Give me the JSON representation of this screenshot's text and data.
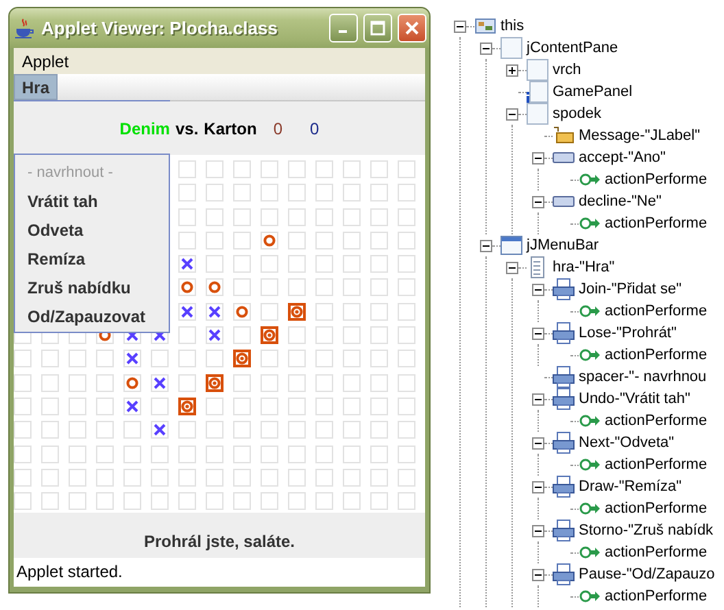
{
  "window": {
    "title": "Applet Viewer: Plocha.class"
  },
  "menu_bar": [
    {
      "label": "Applet"
    }
  ],
  "applet": {
    "menu_bar": [
      {
        "label": "Hra",
        "selected": true
      }
    ],
    "popup_menu": [
      {
        "label": "- navrhnout -",
        "disabled": true
      },
      {
        "label": "Vrátit tah",
        "disabled": false
      },
      {
        "label": "Odveta",
        "disabled": false
      },
      {
        "label": "Remíza",
        "disabled": false
      },
      {
        "label": "Zruš nabídku",
        "disabled": false
      },
      {
        "label": "Od/Zapauzovat",
        "disabled": false
      }
    ],
    "score": {
      "players": [
        {
          "name": "Denim",
          "active": true
        },
        {
          "name": "Karton",
          "active": false
        }
      ],
      "versus": "vs.",
      "score_1": "0",
      "score_2": "0"
    },
    "board": {
      "rows": [
        {
          "cells": [
            {
              "kind": "hidden"
            },
            {
              "kind": "hidden"
            },
            {
              "kind": "hidden"
            },
            {
              "kind": "hidden"
            },
            {
              "kind": "hidden"
            },
            {
              "kind": "hidden"
            },
            {
              "kind": "empty"
            },
            {
              "kind": "empty"
            },
            {
              "kind": "empty"
            },
            {
              "kind": "empty"
            },
            {
              "kind": "empty"
            },
            {
              "kind": "empty"
            },
            {
              "kind": "empty"
            },
            {
              "kind": "empty"
            },
            {
              "kind": "empty"
            }
          ]
        },
        {
          "cells": [
            {
              "kind": "hidden"
            },
            {
              "kind": "hidden"
            },
            {
              "kind": "hidden"
            },
            {
              "kind": "hidden"
            },
            {
              "kind": "hidden"
            },
            {
              "kind": "hidden"
            },
            {
              "kind": "empty"
            },
            {
              "kind": "empty"
            },
            {
              "kind": "empty"
            },
            {
              "kind": "empty"
            },
            {
              "kind": "empty"
            },
            {
              "kind": "empty"
            },
            {
              "kind": "empty"
            },
            {
              "kind": "empty"
            },
            {
              "kind": "empty"
            }
          ]
        },
        {
          "cells": [
            {
              "kind": "hidden"
            },
            {
              "kind": "hidden"
            },
            {
              "kind": "hidden"
            },
            {
              "kind": "hidden"
            },
            {
              "kind": "hidden"
            },
            {
              "kind": "hidden"
            },
            {
              "kind": "empty"
            },
            {
              "kind": "empty"
            },
            {
              "kind": "empty"
            },
            {
              "kind": "empty"
            },
            {
              "kind": "empty"
            },
            {
              "kind": "empty"
            },
            {
              "kind": "empty"
            },
            {
              "kind": "empty"
            },
            {
              "kind": "empty"
            }
          ]
        },
        {
          "cells": [
            {
              "kind": "hidden"
            },
            {
              "kind": "hidden"
            },
            {
              "kind": "hidden"
            },
            {
              "kind": "hidden"
            },
            {
              "kind": "hidden"
            },
            {
              "kind": "hidden"
            },
            {
              "kind": "empty"
            },
            {
              "kind": "empty"
            },
            {
              "kind": "empty"
            },
            {
              "kind": "ring"
            },
            {
              "kind": "empty"
            },
            {
              "kind": "empty"
            },
            {
              "kind": "empty"
            },
            {
              "kind": "empty"
            },
            {
              "kind": "empty"
            }
          ]
        },
        {
          "cells": [
            {
              "kind": "hidden"
            },
            {
              "kind": "hidden"
            },
            {
              "kind": "hidden"
            },
            {
              "kind": "hidden"
            },
            {
              "kind": "hidden"
            },
            {
              "kind": "hidden"
            },
            {
              "kind": "cross"
            },
            {
              "kind": "empty"
            },
            {
              "kind": "empty"
            },
            {
              "kind": "empty"
            },
            {
              "kind": "empty"
            },
            {
              "kind": "empty"
            },
            {
              "kind": "empty"
            },
            {
              "kind": "empty"
            },
            {
              "kind": "empty"
            }
          ]
        },
        {
          "cells": [
            {
              "kind": "hidden"
            },
            {
              "kind": "hidden"
            },
            {
              "kind": "hidden"
            },
            {
              "kind": "hidden"
            },
            {
              "kind": "hidden"
            },
            {
              "kind": "hidden"
            },
            {
              "kind": "ring"
            },
            {
              "kind": "ring"
            },
            {
              "kind": "empty"
            },
            {
              "kind": "empty"
            },
            {
              "kind": "empty"
            },
            {
              "kind": "empty"
            },
            {
              "kind": "empty"
            },
            {
              "kind": "empty"
            },
            {
              "kind": "empty"
            }
          ]
        },
        {
          "cells": [
            {
              "kind": "hidden"
            },
            {
              "kind": "hidden"
            },
            {
              "kind": "hidden"
            },
            {
              "kind": "hidden"
            },
            {
              "kind": "hidden"
            },
            {
              "kind": "hidden"
            },
            {
              "kind": "cross"
            },
            {
              "kind": "cross"
            },
            {
              "kind": "ring"
            },
            {
              "kind": "empty"
            },
            {
              "kind": "winning-ring"
            },
            {
              "kind": "empty"
            },
            {
              "kind": "empty"
            },
            {
              "kind": "empty"
            },
            {
              "kind": "empty"
            }
          ]
        },
        {
          "cells": [
            {
              "kind": "empty"
            },
            {
              "kind": "empty"
            },
            {
              "kind": "empty"
            },
            {
              "kind": "ring"
            },
            {
              "kind": "cross"
            },
            {
              "kind": "cross"
            },
            {
              "kind": "empty"
            },
            {
              "kind": "cross"
            },
            {
              "kind": "empty"
            },
            {
              "kind": "winning-ring"
            },
            {
              "kind": "empty"
            },
            {
              "kind": "empty"
            },
            {
              "kind": "empty"
            },
            {
              "kind": "empty"
            },
            {
              "kind": "empty"
            }
          ]
        },
        {
          "cells": [
            {
              "kind": "empty"
            },
            {
              "kind": "empty"
            },
            {
              "kind": "empty"
            },
            {
              "kind": "empty"
            },
            {
              "kind": "cross"
            },
            {
              "kind": "empty"
            },
            {
              "kind": "empty"
            },
            {
              "kind": "empty"
            },
            {
              "kind": "winning-ring"
            },
            {
              "kind": "empty"
            },
            {
              "kind": "empty"
            },
            {
              "kind": "empty"
            },
            {
              "kind": "empty"
            },
            {
              "kind": "empty"
            },
            {
              "kind": "empty"
            }
          ]
        },
        {
          "cells": [
            {
              "kind": "empty"
            },
            {
              "kind": "empty"
            },
            {
              "kind": "empty"
            },
            {
              "kind": "empty"
            },
            {
              "kind": "ring"
            },
            {
              "kind": "cross"
            },
            {
              "kind": "empty"
            },
            {
              "kind": "winning-ring"
            },
            {
              "kind": "empty"
            },
            {
              "kind": "empty"
            },
            {
              "kind": "empty"
            },
            {
              "kind": "empty"
            },
            {
              "kind": "empty"
            },
            {
              "kind": "empty"
            },
            {
              "kind": "empty"
            }
          ]
        },
        {
          "cells": [
            {
              "kind": "empty"
            },
            {
              "kind": "empty"
            },
            {
              "kind": "empty"
            },
            {
              "kind": "empty"
            },
            {
              "kind": "cross"
            },
            {
              "kind": "empty"
            },
            {
              "kind": "winning-ring"
            },
            {
              "kind": "empty"
            },
            {
              "kind": "empty"
            },
            {
              "kind": "empty"
            },
            {
              "kind": "empty"
            },
            {
              "kind": "empty"
            },
            {
              "kind": "empty"
            },
            {
              "kind": "empty"
            },
            {
              "kind": "empty"
            }
          ]
        },
        {
          "cells": [
            {
              "kind": "empty"
            },
            {
              "kind": "empty"
            },
            {
              "kind": "empty"
            },
            {
              "kind": "empty"
            },
            {
              "kind": "empty"
            },
            {
              "kind": "cross"
            },
            {
              "kind": "empty"
            },
            {
              "kind": "empty"
            },
            {
              "kind": "empty"
            },
            {
              "kind": "empty"
            },
            {
              "kind": "empty"
            },
            {
              "kind": "empty"
            },
            {
              "kind": "empty"
            },
            {
              "kind": "empty"
            },
            {
              "kind": "empty"
            }
          ]
        },
        {
          "cells": [
            {
              "kind": "empty"
            },
            {
              "kind": "empty"
            },
            {
              "kind": "empty"
            },
            {
              "kind": "empty"
            },
            {
              "kind": "empty"
            },
            {
              "kind": "empty"
            },
            {
              "kind": "empty"
            },
            {
              "kind": "empty"
            },
            {
              "kind": "empty"
            },
            {
              "kind": "empty"
            },
            {
              "kind": "empty"
            },
            {
              "kind": "empty"
            },
            {
              "kind": "empty"
            },
            {
              "kind": "empty"
            },
            {
              "kind": "empty"
            }
          ]
        },
        {
          "cells": [
            {
              "kind": "empty"
            },
            {
              "kind": "empty"
            },
            {
              "kind": "empty"
            },
            {
              "kind": "empty"
            },
            {
              "kind": "empty"
            },
            {
              "kind": "empty"
            },
            {
              "kind": "empty"
            },
            {
              "kind": "empty"
            },
            {
              "kind": "empty"
            },
            {
              "kind": "empty"
            },
            {
              "kind": "empty"
            },
            {
              "kind": "empty"
            },
            {
              "kind": "empty"
            },
            {
              "kind": "empty"
            },
            {
              "kind": "empty"
            }
          ]
        },
        {
          "cells": [
            {
              "kind": "empty"
            },
            {
              "kind": "empty"
            },
            {
              "kind": "empty"
            },
            {
              "kind": "empty"
            },
            {
              "kind": "empty"
            },
            {
              "kind": "empty"
            },
            {
              "kind": "empty"
            },
            {
              "kind": "empty"
            },
            {
              "kind": "empty"
            },
            {
              "kind": "empty"
            },
            {
              "kind": "empty"
            },
            {
              "kind": "empty"
            },
            {
              "kind": "empty"
            },
            {
              "kind": "empty"
            },
            {
              "kind": "empty"
            }
          ]
        }
      ]
    },
    "message": "Prohrál jste, saláte."
  },
  "status_bar": "Applet started.",
  "tree": [
    {
      "label": "this",
      "kind": "bean",
      "expanded": true,
      "children": [
        {
          "label": "jContentPane",
          "kind": "panel",
          "expanded": true,
          "children": [
            {
              "label": "vrch",
              "kind": "panel",
              "expanded": false
            },
            {
              "label": "GamePanel",
              "kind": "custom-panel"
            },
            {
              "label": "spodek",
              "kind": "panel",
              "expanded": true,
              "children": [
                {
                  "label": "Message-\"JLabel\"",
                  "kind": "label"
                },
                {
                  "label": "accept-\"Ano\"",
                  "kind": "button",
                  "expanded": true,
                  "children": [
                    {
                      "label": "actionPerforme",
                      "kind": "event"
                    }
                  ]
                },
                {
                  "label": "decline-\"Ne\"",
                  "kind": "button",
                  "expanded": true,
                  "children": [
                    {
                      "label": "actionPerforme",
                      "kind": "event"
                    }
                  ]
                }
              ]
            }
          ]
        },
        {
          "label": "jJMenuBar",
          "kind": "menubar",
          "expanded": true,
          "children": [
            {
              "label": "hra-\"Hra\"",
              "kind": "menu",
              "expanded": true,
              "children": [
                {
                  "label": "Join-\"Přidat se\"",
                  "kind": "menuitem",
                  "expanded": true,
                  "children": [
                    {
                      "label": "actionPerforme",
                      "kind": "event"
                    }
                  ]
                },
                {
                  "label": "Lose-\"Prohrát\"",
                  "kind": "menuitem",
                  "expanded": true,
                  "children": [
                    {
                      "label": "actionPerforme",
                      "kind": "event"
                    }
                  ]
                },
                {
                  "label": "spacer-\"- navrhnou",
                  "kind": "menuitem"
                },
                {
                  "label": "Undo-\"Vrátit tah\"",
                  "kind": "menuitem",
                  "expanded": true,
                  "children": [
                    {
                      "label": "actionPerforme",
                      "kind": "event"
                    }
                  ]
                },
                {
                  "label": "Next-\"Odveta\"",
                  "kind": "menuitem",
                  "expanded": true,
                  "children": [
                    {
                      "label": "actionPerforme",
                      "kind": "event"
                    }
                  ]
                },
                {
                  "label": "Draw-\"Remíza\"",
                  "kind": "menuitem",
                  "expanded": true,
                  "children": [
                    {
                      "label": "actionPerforme",
                      "kind": "event"
                    }
                  ]
                },
                {
                  "label": "Storno-\"Zruš nabídk",
                  "kind": "menuitem",
                  "expanded": true,
                  "children": [
                    {
                      "label": "actionPerforme",
                      "kind": "event"
                    }
                  ]
                },
                {
                  "label": "Pause-\"Od/Zapauzo",
                  "kind": "menuitem",
                  "expanded": true,
                  "children": [
                    {
                      "label": "actionPerforme",
                      "kind": "event"
                    }
                  ]
                }
              ]
            }
          ]
        }
      ]
    }
  ]
}
